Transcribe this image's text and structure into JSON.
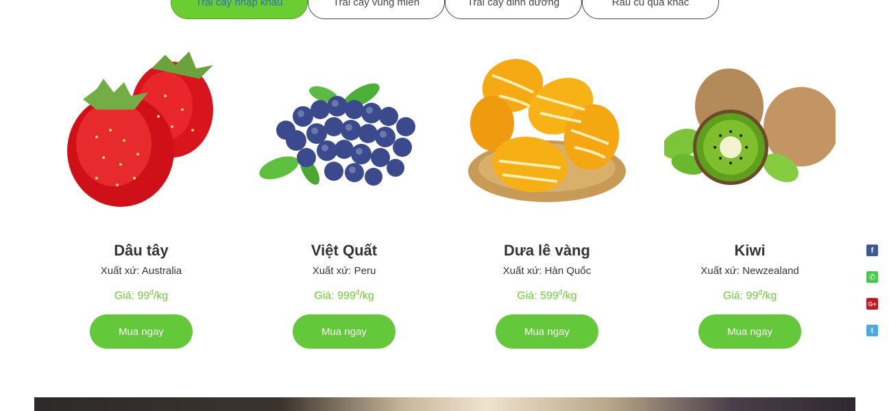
{
  "tabs": [
    {
      "label": "Trái cây nhập khẩu",
      "active": true
    },
    {
      "label": "Trái cây vùng miền",
      "active": false
    },
    {
      "label": "Trái cây dinh dưỡng",
      "active": false
    },
    {
      "label": "Rau củ quả khác",
      "active": false
    }
  ],
  "products": [
    {
      "name": "Dâu tây",
      "origin": "Xuất xứ: Australia",
      "price_prefix": "Giá: 99",
      "currency": "đ",
      "unit": "/kg",
      "buy_label": "Mua ngay",
      "image": "strawberry"
    },
    {
      "name": "Việt Quất",
      "origin": "Xuất xứ: Peru",
      "price_prefix": "Giá: 999",
      "currency": "đ",
      "unit": "/kg",
      "buy_label": "Mua ngay",
      "image": "blueberry"
    },
    {
      "name": "Dưa lê vàng",
      "origin": "Xuất xứ: Hàn Quốc",
      "price_prefix": "Giá: 599",
      "currency": "đ",
      "unit": "/kg",
      "buy_label": "Mua ngay",
      "image": "yellow-melon"
    },
    {
      "name": "Kiwi",
      "origin": "Xuất xứ: Newzealand",
      "price_prefix": "Giá: 99",
      "currency": "đ",
      "unit": "/kg",
      "buy_label": "Mua ngay",
      "image": "kiwi"
    }
  ],
  "social": [
    {
      "icon": "facebook-icon",
      "glyph": "f",
      "color": "#3b5998"
    },
    {
      "icon": "phone-icon",
      "glyph": "✆",
      "color": "#4cc94c"
    },
    {
      "icon": "google-plus-icon",
      "glyph": "G+",
      "color": "#c5161d"
    },
    {
      "icon": "twitter-icon",
      "glyph": "t",
      "color": "#4ba9e6"
    }
  ],
  "colors": {
    "accent": "#6ccd33",
    "button": "#63c83a",
    "text": "#333333"
  }
}
